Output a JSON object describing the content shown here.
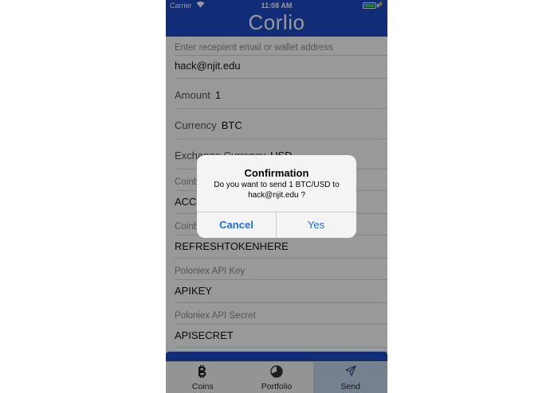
{
  "status": {
    "carrier": "Carrier",
    "time": "11:08 AM"
  },
  "app": {
    "title": "Corlio"
  },
  "form": {
    "recipient_hint": "Enter recepient email or wallet address",
    "recipient_value": "hack@njit.edu",
    "amount_label": "Amount",
    "amount_value": "1",
    "currency_label": "Currency",
    "currency_value": "BTC",
    "exchange_label": "Exchange Currency",
    "exchange_value": "USD",
    "coinbase_key_hint": "Coinbase API Key",
    "coinbase_key_value": "ACCESSTOKENHERE",
    "coinbase_refresh_hint": "Coinbase Refresh Token",
    "coinbase_refresh_value": "REFRESHTOKENHERE",
    "poloniex_key_hint": "Poloniex API Key",
    "poloniex_key_value": "APIKEY",
    "poloniex_secret_hint": "Poloniex API Secret",
    "poloniex_secret_value": "APISECRET"
  },
  "tabs": [
    {
      "label": "Coins",
      "icon": "bitcoin-icon"
    },
    {
      "label": "Portfolio",
      "icon": "pie-chart-icon"
    },
    {
      "label": "Send",
      "icon": "paper-plane-icon"
    }
  ],
  "active_tab": "Send",
  "alert": {
    "title": "Confirmation",
    "message": "Do you want to send 1 BTC/USD to hack@njit.edu ?",
    "cancel_label": "Cancel",
    "confirm_label": "Yes"
  },
  "colors": {
    "nav_bar": "#1f4cc6",
    "alert_button": "#1b6ee8",
    "active_tab": "#c5d7ee",
    "battery": "#3ad14a"
  }
}
